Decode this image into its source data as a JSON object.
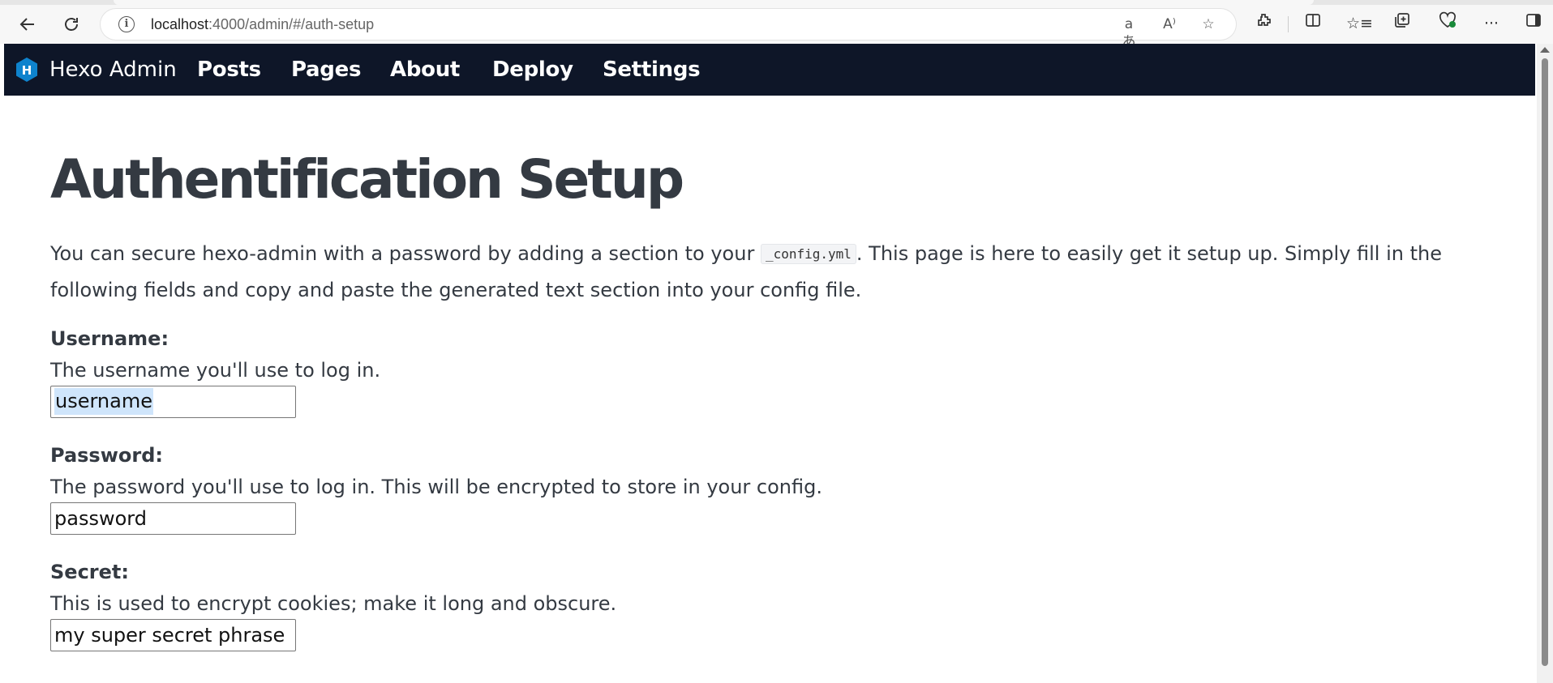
{
  "browser": {
    "url_host": "localhost",
    "url_rest": ":4000/admin/#/auth-setup"
  },
  "app": {
    "brand": "Hexo Admin",
    "logo_letter": "H",
    "nav": [
      "Posts",
      "Pages",
      "About",
      "Deploy",
      "Settings"
    ]
  },
  "page": {
    "title": "Authentification Setup",
    "intro_before": "You can secure hexo-admin with a password by adding a section to your ",
    "intro_code": "_config.yml",
    "intro_after": ". This page is here to easily get it setup up. Simply fill in the following fields and copy and paste the generated text section into your config file."
  },
  "fields": [
    {
      "label": "Username:",
      "description": "The username you'll use to log in.",
      "value": "username"
    },
    {
      "label": "Password:",
      "description": "The password you'll use to log in. This will be encrypted to store in your config.",
      "value": "password"
    },
    {
      "label": "Secret:",
      "description": "This is used to encrypt cookies; make it long and obscure.",
      "value": "my super secret phrase"
    }
  ],
  "colors": {
    "navbar": "#0e1628",
    "logo": "#0e83cd",
    "text": "#343a42",
    "selection": "#cfe5fb"
  }
}
